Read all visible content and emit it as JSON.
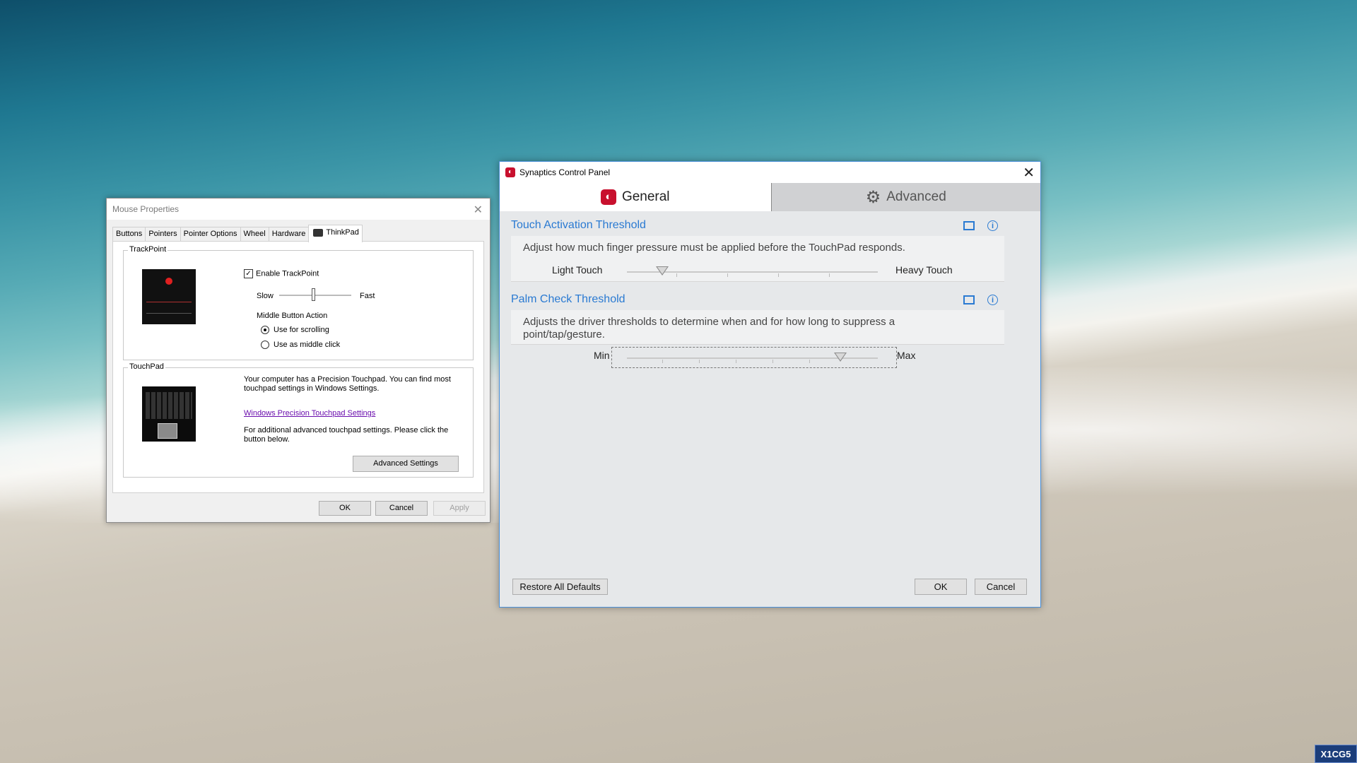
{
  "desktop": {
    "badge": "X1CG5"
  },
  "mouse_props": {
    "title": "Mouse Properties",
    "tabs": [
      "Buttons",
      "Pointers",
      "Pointer Options",
      "Wheel",
      "Hardware",
      "ThinkPad"
    ],
    "trackpoint": {
      "group": "TrackPoint",
      "enable_label": "Enable TrackPoint",
      "slow": "Slow",
      "fast": "Fast",
      "middle_action": "Middle Button Action",
      "opt_scroll": "Use for scrolling",
      "opt_middle": "Use as middle click"
    },
    "touchpad": {
      "group": "TouchPad",
      "desc1": "Your computer has a Precision Touchpad. You can find most touchpad settings in Windows Settings.",
      "link": "Windows Precision Touchpad Settings",
      "desc2": "For additional advanced touchpad settings. Please click the button below.",
      "adv_button": "Advanced Settings"
    },
    "ok": "OK",
    "cancel": "Cancel",
    "apply": "Apply"
  },
  "synaptics": {
    "title": "Synaptics Control Panel",
    "tab_general": "General",
    "tab_advanced": "Advanced",
    "touch": {
      "title": "Touch Activation Threshold",
      "desc": "Adjust how much finger pressure must be applied before the TouchPad responds.",
      "left": "Light Touch",
      "right": "Heavy Touch",
      "value": 0.14
    },
    "palm": {
      "title": "Palm Check Threshold",
      "desc": "Adjusts the driver thresholds to determine when and for how long to suppress a point/tap/gesture.",
      "left": "Min",
      "right": "Max",
      "value": 0.85
    },
    "restore": "Restore All Defaults",
    "ok": "OK",
    "cancel": "Cancel"
  }
}
